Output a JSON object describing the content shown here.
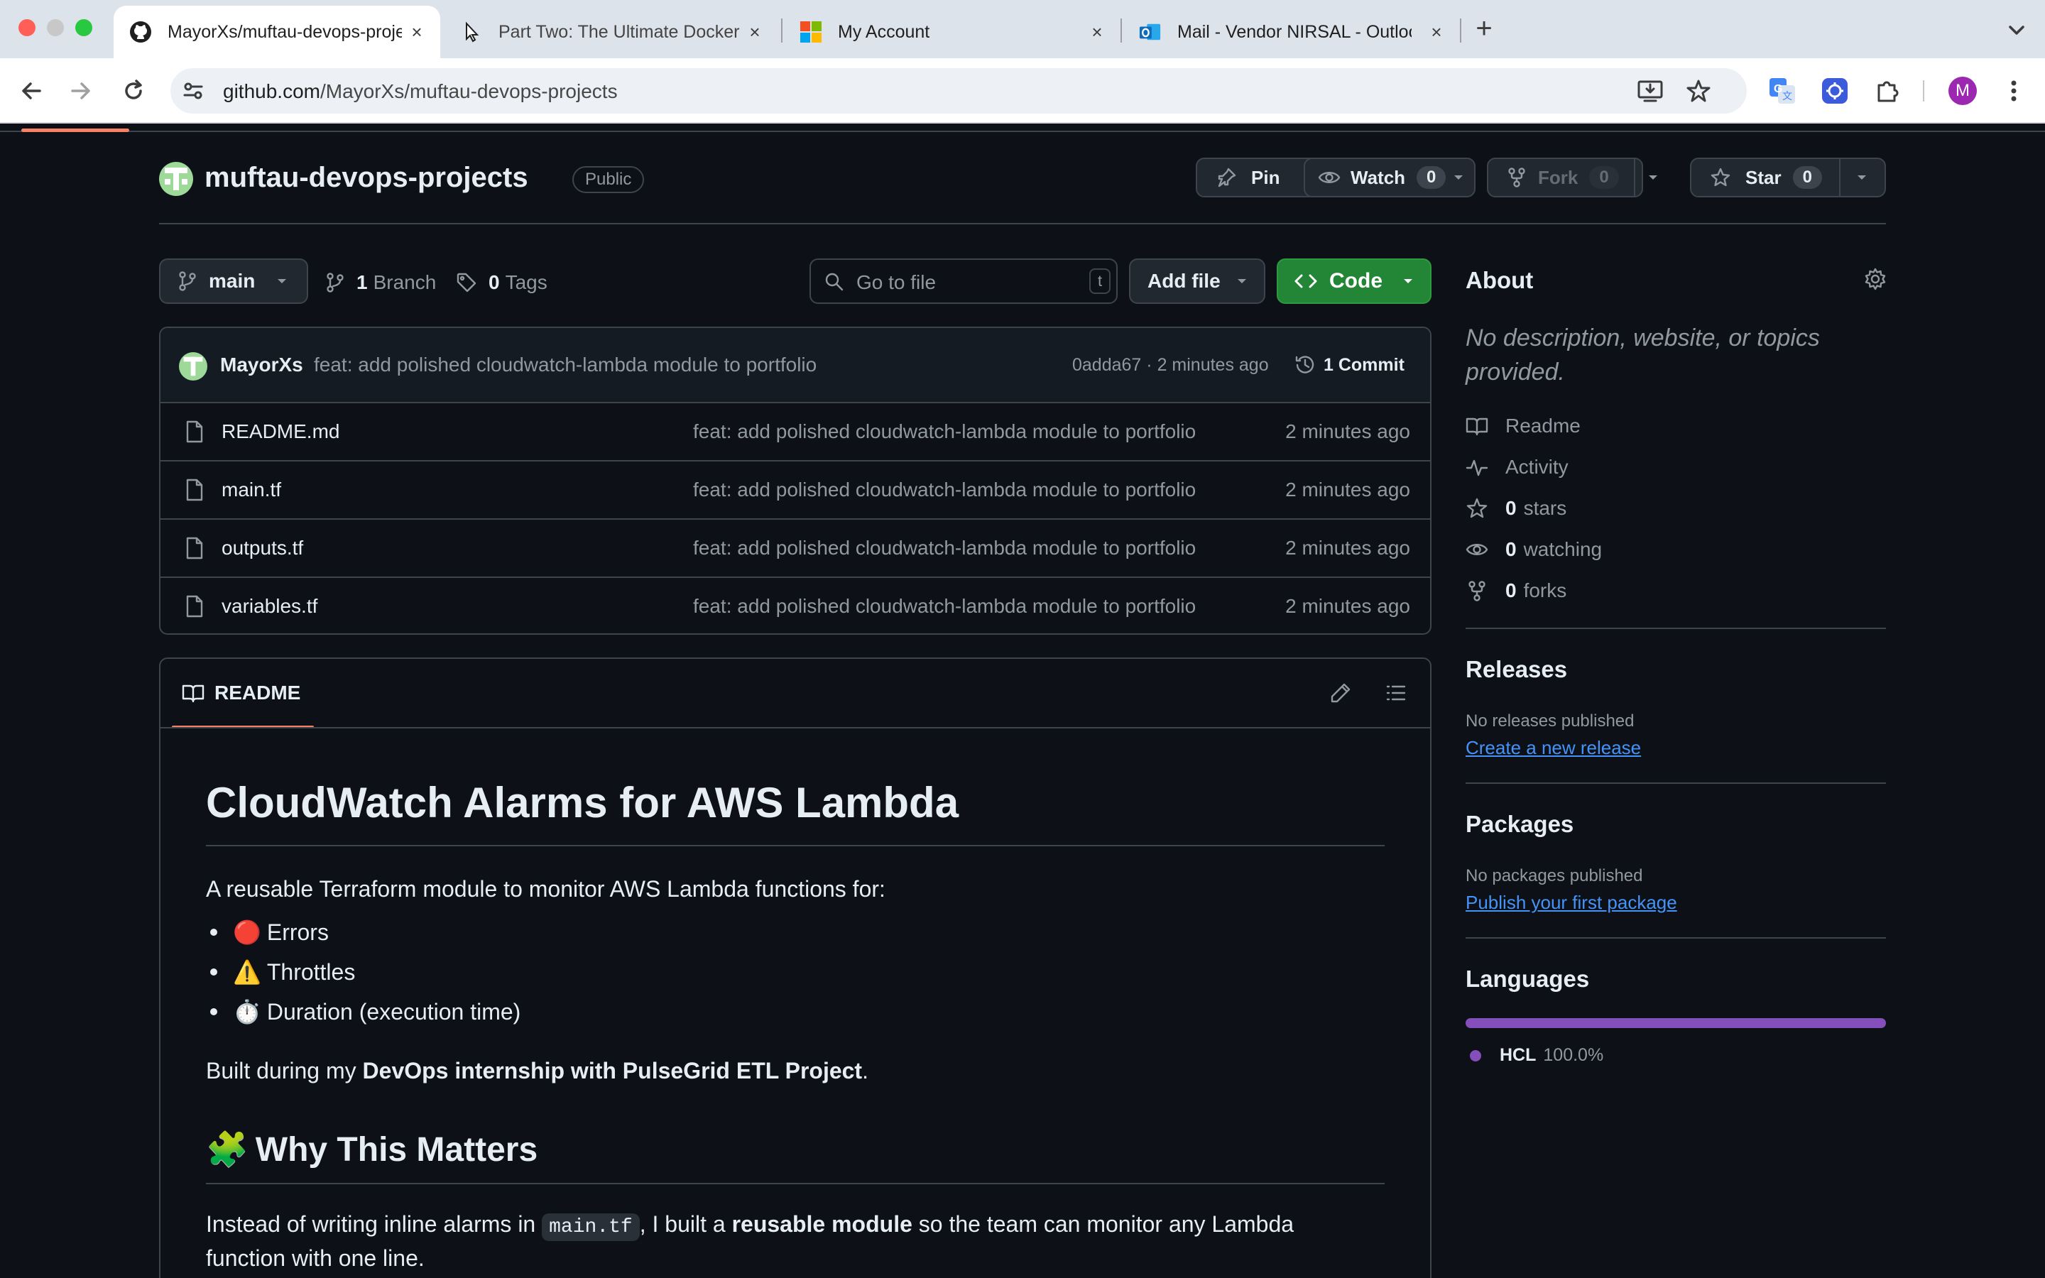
{
  "browser": {
    "tabs": [
      {
        "title": "MayorXs/muftau-devops-projects",
        "icon": "github-icon"
      },
      {
        "title": "Part Two: The Ultimate Docker",
        "icon": "cursor-icon"
      },
      {
        "title": "My Account",
        "icon": "microsoft-icon"
      },
      {
        "title": "Mail - Vendor NIRSAL - Outlook",
        "icon": "outlook-icon"
      }
    ],
    "url_host": "github.com",
    "url_path": "/MayorXs/muftau-devops-projects",
    "profile_initial": "M"
  },
  "repo": {
    "name": "muftau-devops-projects",
    "visibility": "Public",
    "pin_label": "Pin",
    "watch_label": "Watch",
    "watch_count": "0",
    "fork_label": "Fork",
    "fork_count": "0",
    "star_label": "Star",
    "star_count": "0"
  },
  "filebar": {
    "branch": "main",
    "branch_count": "1",
    "branch_label": "Branch",
    "tag_count": "0",
    "tag_label": "Tags",
    "goto_placeholder": "Go to file",
    "goto_shortcut": "t",
    "add_file_label": "Add file",
    "code_label": "Code"
  },
  "commit": {
    "author": "MayorXs",
    "message": "feat: add polished cloudwatch-lambda module to portfolio",
    "sha": "0adda67",
    "sep": "·",
    "time": "2 minutes ago",
    "count_label": "1 Commit"
  },
  "files": [
    {
      "name": "README.md",
      "message": "feat: add polished cloudwatch-lambda module to portfolio",
      "time": "2 minutes ago"
    },
    {
      "name": "main.tf",
      "message": "feat: add polished cloudwatch-lambda module to portfolio",
      "time": "2 minutes ago"
    },
    {
      "name": "outputs.tf",
      "message": "feat: add polished cloudwatch-lambda module to portfolio",
      "time": "2 minutes ago"
    },
    {
      "name": "variables.tf",
      "message": "feat: add polished cloudwatch-lambda module to portfolio",
      "time": "2 minutes ago"
    }
  ],
  "readme": {
    "tab_label": "README",
    "h1": "CloudWatch Alarms for AWS Lambda",
    "intro": "A reusable Terraform module to monitor AWS Lambda functions for:",
    "bullets": [
      {
        "emoji": "🔴",
        "text": "Errors"
      },
      {
        "emoji": "⚠️",
        "text": "Throttles"
      },
      {
        "emoji": "⏱️",
        "text": "Duration (execution time)"
      }
    ],
    "built_prefix": "Built during my ",
    "built_bold": "DevOps internship with PulseGrid ETL Project",
    "built_suffix": ".",
    "h2_emoji": "🧩",
    "h2_text": "Why This Matters",
    "p_prefix": "Instead of writing inline alarms in ",
    "p_code": "main.tf",
    "p_mid": ", I built a ",
    "p_bold": "reusable module",
    "p_suffix": " so the team can monitor any Lambda",
    "p_line2": "function with one line."
  },
  "about": {
    "heading": "About",
    "description": "No description, website, or topics provided.",
    "readme_label": "Readme",
    "activity_label": "Activity",
    "stars_count": "0",
    "stars_label": "stars",
    "watching_count": "0",
    "watching_label": "watching",
    "forks_count": "0",
    "forks_label": "forks"
  },
  "releases": {
    "heading": "Releases",
    "empty": "No releases published",
    "link": "Create a new release"
  },
  "packages": {
    "heading": "Packages",
    "empty": "No packages published",
    "link": "Publish your first package"
  },
  "languages": {
    "heading": "Languages",
    "items": [
      {
        "name": "HCL",
        "percent": "100.0%",
        "color": "#844fba"
      }
    ]
  },
  "colors": {
    "accent_green": "#238636",
    "link_blue": "#4493f8",
    "tab_underline": "#f78166"
  }
}
